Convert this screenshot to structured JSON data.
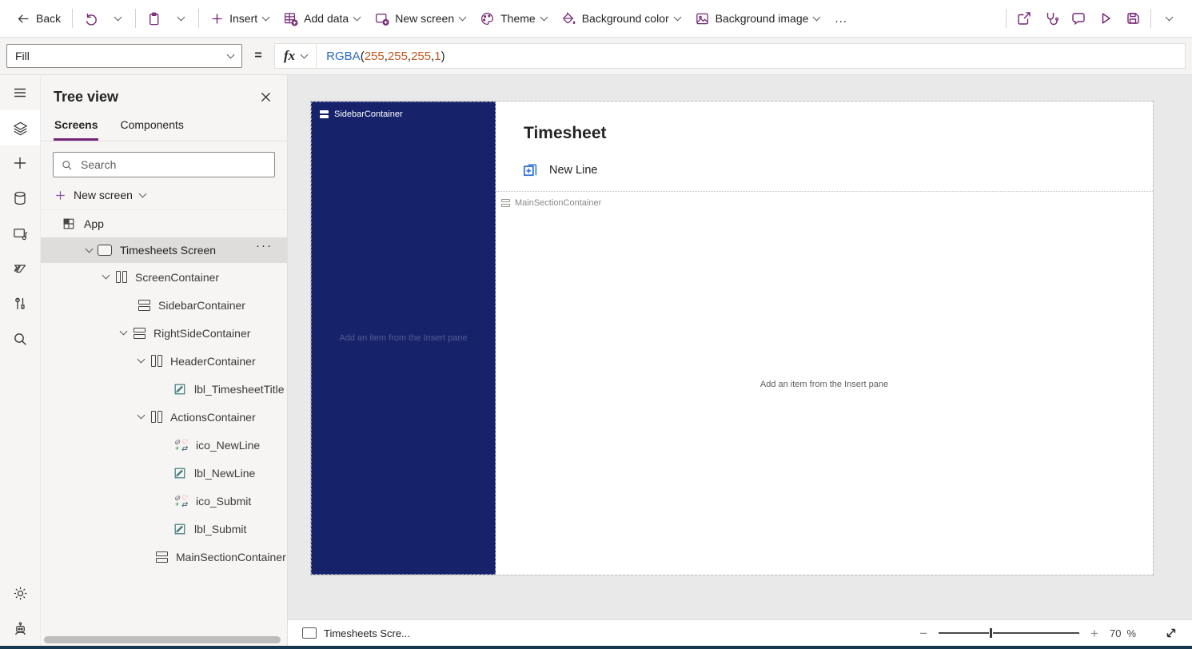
{
  "colors": {
    "accent_purple": "#742774",
    "canvas_sidebar_navy": "#16236B",
    "formula_function_blue": "#2B6BC0",
    "formula_number_orange": "#C05A21",
    "selected_row_gray": "#DEDDDC"
  },
  "toolbar": {
    "back": "Back",
    "insert": "Insert",
    "add_data": "Add data",
    "new_screen": "New screen",
    "theme": "Theme",
    "background_color": "Background color",
    "background_image": "Background image",
    "overflow": "..."
  },
  "formula_bar": {
    "property": "Fill",
    "equals": "=",
    "fx": "fx",
    "formula": {
      "fn": "RGBA",
      "lparen": "(",
      "comma": ", ",
      "r": "255",
      "g": "255",
      "b": "255",
      "a": "1",
      "rparen": ")"
    }
  },
  "tree": {
    "title": "Tree view",
    "tabs": [
      "Screens",
      "Components"
    ],
    "search_placeholder": "Search",
    "new_screen": "New screen",
    "app": "App",
    "screen_row": {
      "label": "Timesheets Screen",
      "more": "···"
    },
    "rows": [
      {
        "label": "ScreenContainer"
      },
      {
        "label": "SidebarContainer"
      },
      {
        "label": "RightSideContainer"
      },
      {
        "label": "HeaderContainer"
      },
      {
        "label": "lbl_TimesheetTitle"
      },
      {
        "label": "ActionsContainer"
      },
      {
        "label": "ico_NewLine"
      },
      {
        "label": "lbl_NewLine"
      },
      {
        "label": "ico_Submit"
      },
      {
        "label": "lbl_Submit"
      },
      {
        "label": "MainSectionContainer"
      }
    ]
  },
  "icons": {
    "ctl_glyphs": [
      "⊘",
      "♡",
      "+",
      "⇄"
    ]
  },
  "canvas": {
    "sidebar": {
      "label": "SidebarContainer",
      "placeholder": "Add an item from the Insert pane"
    },
    "title": "Timesheet",
    "new_line": "New Line",
    "main": {
      "label": "MainSectionContainer",
      "placeholder": "Add an item from the Insert pane"
    }
  },
  "status_bar": {
    "screen_label": "Timesheets Scre...",
    "zoom_out": "−",
    "zoom_in": "+",
    "zoom_value": "70",
    "zoom_unit": "%"
  }
}
